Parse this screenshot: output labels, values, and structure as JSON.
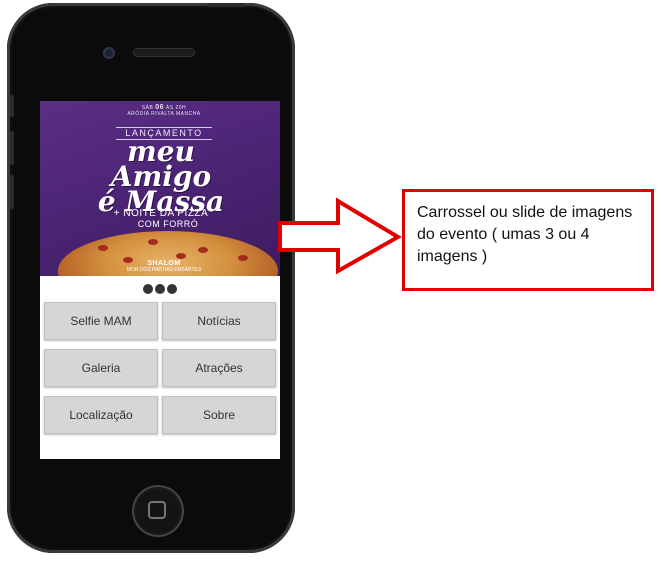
{
  "banner": {
    "top_line1": "SÁB",
    "top_date": "06",
    "top_line2": "ÀS 20H",
    "top_line3": "ARÓDIA RIVALTA MANCHA",
    "launch": "LANÇAMENTO",
    "title_line1": "meu",
    "title_line2": "Amigo",
    "title_line3": "é Massa",
    "sub1": "+ NOITE DA PIZZA",
    "sub2": "COM FORRÓ",
    "brand": "SHALOM",
    "footer": "MOR DOS PARTIAS ENSÁRTES"
  },
  "carousel": {
    "dots": 3
  },
  "menu": {
    "selfie": "Selfie MAM",
    "noticias": "Notícias",
    "galeria": "Galeria",
    "atracoes": "Atrações",
    "localizacao": "Localização",
    "sobre": "Sobre"
  },
  "annotation": {
    "text": "Carrossel ou slide de imagens do evento ( umas 3 ou 4 imagens )",
    "border_color": "#e00000"
  },
  "icons": {
    "arrow": "right-arrow-icon",
    "home": "home-button-icon"
  }
}
